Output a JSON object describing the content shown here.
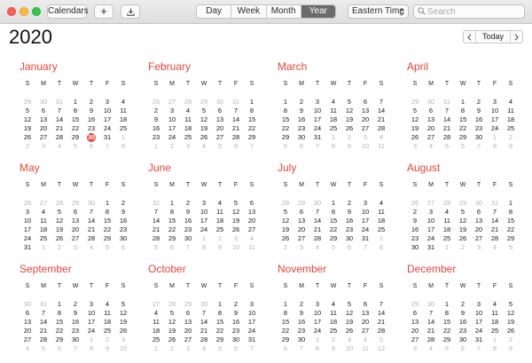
{
  "toolbar": {
    "calendars_label": "Calendars",
    "add_label": "+",
    "views": [
      "Day",
      "Week",
      "Month",
      "Year"
    ],
    "active_view": "Year",
    "timezone_label": "Eastern Time",
    "search_placeholder": "Search"
  },
  "year": "2020",
  "nav": {
    "today_label": "Today"
  },
  "weekday_headers": [
    "S",
    "M",
    "T",
    "W",
    "T",
    "F",
    "S"
  ],
  "today": {
    "month": 0,
    "day": 30
  },
  "months": [
    {
      "name": "January",
      "days": [
        "29",
        "30",
        "31",
        "1",
        "2",
        "3",
        "4",
        "5",
        "6",
        "7",
        "8",
        "9",
        "10",
        "11",
        "12",
        "13",
        "14",
        "15",
        "16",
        "17",
        "18",
        "19",
        "20",
        "21",
        "22",
        "23",
        "24",
        "25",
        "26",
        "27",
        "28",
        "29",
        "30",
        "31",
        "1",
        "2",
        "3",
        "4",
        "5",
        "6",
        "7",
        "8"
      ]
    },
    {
      "name": "February",
      "days": [
        "26",
        "27",
        "28",
        "29",
        "30",
        "31",
        "1",
        "2",
        "3",
        "4",
        "5",
        "6",
        "7",
        "8",
        "9",
        "10",
        "11",
        "12",
        "13",
        "14",
        "15",
        "16",
        "17",
        "18",
        "19",
        "20",
        "21",
        "22",
        "23",
        "24",
        "25",
        "26",
        "27",
        "28",
        "29",
        "1",
        "2",
        "3",
        "4",
        "5",
        "6",
        "7"
      ]
    },
    {
      "name": "March",
      "days": [
        "1",
        "2",
        "3",
        "4",
        "5",
        "6",
        "7",
        "8",
        "9",
        "10",
        "11",
        "12",
        "13",
        "14",
        "15",
        "16",
        "17",
        "18",
        "19",
        "20",
        "21",
        "22",
        "23",
        "24",
        "25",
        "26",
        "27",
        "28",
        "29",
        "30",
        "31",
        "1",
        "2",
        "3",
        "4",
        "5",
        "6",
        "7",
        "8",
        "9",
        "10",
        "11"
      ]
    },
    {
      "name": "April",
      "days": [
        "29",
        "30",
        "31",
        "1",
        "2",
        "3",
        "4",
        "5",
        "6",
        "7",
        "8",
        "9",
        "10",
        "11",
        "12",
        "13",
        "14",
        "15",
        "16",
        "17",
        "18",
        "19",
        "20",
        "21",
        "22",
        "23",
        "24",
        "25",
        "26",
        "27",
        "28",
        "29",
        "30",
        "1",
        "2",
        "3",
        "4",
        "5",
        "6",
        "7",
        "8",
        "9"
      ]
    },
    {
      "name": "May",
      "days": [
        "26",
        "27",
        "28",
        "29",
        "30",
        "1",
        "2",
        "3",
        "4",
        "5",
        "6",
        "7",
        "8",
        "9",
        "10",
        "11",
        "12",
        "13",
        "14",
        "15",
        "16",
        "17",
        "18",
        "19",
        "20",
        "21",
        "22",
        "23",
        "24",
        "25",
        "26",
        "27",
        "28",
        "29",
        "30",
        "31",
        "1",
        "2",
        "3",
        "4",
        "5",
        "6"
      ]
    },
    {
      "name": "June",
      "days": [
        "31",
        "1",
        "2",
        "3",
        "4",
        "5",
        "6",
        "7",
        "8",
        "9",
        "10",
        "11",
        "12",
        "13",
        "14",
        "15",
        "16",
        "17",
        "18",
        "19",
        "20",
        "21",
        "22",
        "23",
        "24",
        "25",
        "26",
        "27",
        "28",
        "29",
        "30",
        "1",
        "2",
        "3",
        "4",
        "5",
        "6",
        "7",
        "8",
        "9",
        "10",
        "11"
      ]
    },
    {
      "name": "July",
      "days": [
        "28",
        "29",
        "30",
        "1",
        "2",
        "3",
        "4",
        "5",
        "6",
        "7",
        "8",
        "9",
        "10",
        "11",
        "12",
        "13",
        "14",
        "15",
        "16",
        "17",
        "18",
        "19",
        "20",
        "21",
        "22",
        "23",
        "24",
        "25",
        "26",
        "27",
        "28",
        "29",
        "30",
        "31",
        "1",
        "2",
        "3",
        "4",
        "5",
        "6",
        "7",
        "8"
      ]
    },
    {
      "name": "August",
      "days": [
        "26",
        "27",
        "28",
        "29",
        "30",
        "31",
        "1",
        "2",
        "3",
        "4",
        "5",
        "6",
        "7",
        "8",
        "9",
        "10",
        "11",
        "12",
        "13",
        "14",
        "15",
        "16",
        "17",
        "18",
        "19",
        "20",
        "21",
        "22",
        "23",
        "24",
        "25",
        "26",
        "27",
        "28",
        "29",
        "30",
        "31",
        "1",
        "2",
        "3",
        "4",
        "5"
      ]
    },
    {
      "name": "September",
      "days": [
        "30",
        "31",
        "1",
        "2",
        "3",
        "4",
        "5",
        "6",
        "7",
        "8",
        "9",
        "10",
        "11",
        "12",
        "13",
        "14",
        "15",
        "16",
        "17",
        "18",
        "19",
        "20",
        "21",
        "22",
        "23",
        "24",
        "25",
        "26",
        "27",
        "28",
        "29",
        "30",
        "1",
        "2",
        "3",
        "4",
        "5",
        "6",
        "7",
        "8",
        "9",
        "10"
      ]
    },
    {
      "name": "October",
      "days": [
        "27",
        "28",
        "29",
        "30",
        "1",
        "2",
        "3",
        "4",
        "5",
        "6",
        "7",
        "8",
        "9",
        "10",
        "11",
        "12",
        "13",
        "14",
        "15",
        "16",
        "17",
        "18",
        "19",
        "20",
        "21",
        "22",
        "23",
        "24",
        "25",
        "26",
        "27",
        "28",
        "29",
        "30",
        "31",
        "1",
        "2",
        "3",
        "4",
        "5",
        "6",
        "7"
      ]
    },
    {
      "name": "November",
      "days": [
        "1",
        "2",
        "3",
        "4",
        "5",
        "6",
        "7",
        "8",
        "9",
        "10",
        "11",
        "12",
        "13",
        "14",
        "15",
        "16",
        "17",
        "18",
        "19",
        "20",
        "21",
        "22",
        "23",
        "24",
        "25",
        "26",
        "27",
        "28",
        "29",
        "30",
        "1",
        "2",
        "3",
        "4",
        "5",
        "6",
        "7",
        "8",
        "9",
        "10",
        "11",
        "12"
      ]
    },
    {
      "name": "December",
      "days": [
        "29",
        "30",
        "1",
        "2",
        "3",
        "4",
        "5",
        "6",
        "7",
        "8",
        "9",
        "10",
        "11",
        "12",
        "13",
        "14",
        "15",
        "16",
        "17",
        "18",
        "19",
        "20",
        "21",
        "22",
        "23",
        "24",
        "25",
        "26",
        "27",
        "28",
        "29",
        "30",
        "31",
        "1",
        "2",
        "3",
        "4",
        "5",
        "6",
        "7",
        "8",
        "9"
      ]
    }
  ],
  "colors": {
    "accent": "#e8453c",
    "dim_day": "#b4b4b4",
    "active_segment": "#6b6b6b"
  }
}
